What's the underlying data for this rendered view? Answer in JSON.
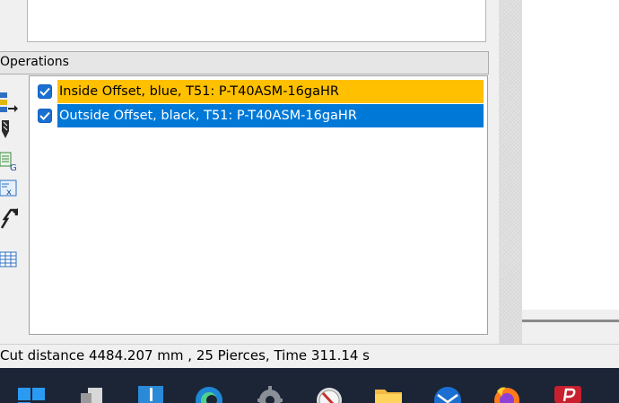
{
  "operations": {
    "title": "Operations",
    "items": [
      {
        "label": "Inside Offset, blue, T51: P-T40ASM-16gaHR",
        "checked": true,
        "highlight": "#ffc000"
      },
      {
        "label": "Outside Offset, black, T51: P-T40ASM-16gaHR",
        "checked": true,
        "highlight": "#0078d7"
      }
    ]
  },
  "toolbar_icons": [
    "sequence-arrow-icon",
    "drill-icon",
    "nc-code-icon",
    "excel-export-icon",
    "direction-arrow-icon",
    "table-icon"
  ],
  "status": {
    "text": "Cut distance 4484.207 mm , 25 Pierces, Time 311.14 s"
  },
  "taskbar": {
    "icons": [
      "windows-start-icon",
      "file-app-icon",
      "app-icon",
      "edge-browser-icon",
      "settings-gear-icon",
      "compass-app-icon",
      "file-explorer-icon",
      "mail-icon",
      "firefox-icon",
      "red-app-icon"
    ]
  },
  "colors": {
    "accent_blue": "#0078d7",
    "selection_yellow": "#ffc000",
    "taskbar": "#1b2536"
  }
}
